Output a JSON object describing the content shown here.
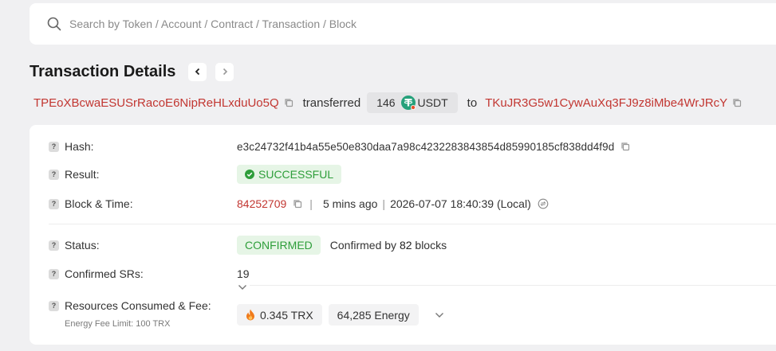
{
  "search": {
    "placeholder": "Search by Token / Account / Contract / Transaction / Block"
  },
  "header": {
    "title": "Transaction Details"
  },
  "transfer": {
    "from": "TPEoXBcwaESUSrRacoE6NipReHLxduUo5Q",
    "verb": "transferred",
    "amount": "146",
    "token": "USDT",
    "to_word": "to",
    "to": "TKuJR3G5w1CywAuXq3FJ9z8iMbe4WrJRcY"
  },
  "details": {
    "hash_label": "Hash:",
    "hash": "e3c24732f41b4a55e50e830daa7a98c4232283843854d85990185cf838dd4f9d",
    "result_label": "Result:",
    "result": "SUCCESSFUL",
    "block_label": "Block & Time:",
    "block": "84252709",
    "age": "5 mins ago",
    "datetime": "2026-07-07 18:40:39 (Local)",
    "status_label": "Status:",
    "status": "CONFIRMED",
    "confirmed_by_prefix": "Confirmed by",
    "confirmed_count": "82",
    "confirmed_by_suffix": "blocks",
    "srs_label": "Confirmed SRs:",
    "srs": "19",
    "resources_label": "Resources Consumed & Fee:",
    "energy_limit": "Energy Fee Limit: 100 TRX",
    "fee_trx": "0.345 TRX",
    "energy": "64,285 Energy"
  },
  "colors": {
    "address": "#c23631",
    "success_bg": "#e6f5e6",
    "success_text": "#2e9e3a",
    "token": "#26a17b",
    "fire": "#f07a1a"
  },
  "icons": [
    "search-icon",
    "chevron-left-icon",
    "chevron-right-icon",
    "copy-icon",
    "usdt-token-icon",
    "check-circle-icon",
    "clock-convert-icon",
    "chevron-down-icon",
    "fire-icon",
    "question-icon"
  ]
}
